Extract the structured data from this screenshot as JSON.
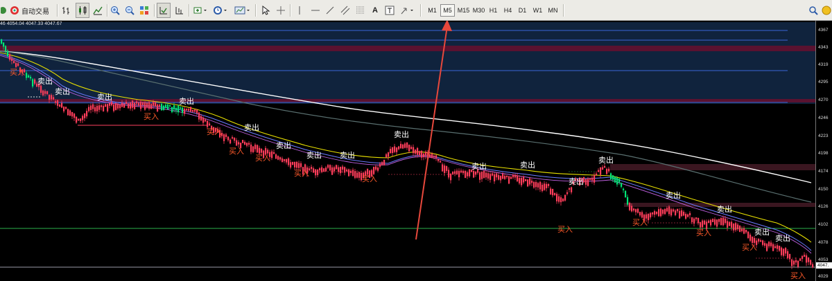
{
  "toolbar": {
    "autotrade_label": "自动交易",
    "text_tool_label": "A",
    "timeframes": [
      "M1",
      "M5",
      "M15",
      "M30",
      "H1",
      "H4",
      "D1",
      "W1",
      "MN"
    ],
    "active_timeframe": "M5"
  },
  "ohlc_text": "46 4054.04 4047.33 4047.67",
  "price_axis": {
    "labels": [
      "4367",
      "4343",
      "4319",
      "4295",
      "4270",
      "4246",
      "4223",
      "4198",
      "4174",
      "4150",
      "4126",
      "4102",
      "4078",
      "4053",
      "4029"
    ],
    "current_price": "4047."
  },
  "signals": {
    "sell_label": "卖出",
    "buy_label": "买入"
  },
  "colors": {
    "background": "#000000",
    "bull_candle": "#00e676",
    "bear_candle": "#ff3d5a",
    "ma_white": "#ffffff",
    "ma_grey": "#5a7070",
    "ma_yellow": "#e8e000",
    "ma_blue": "#4a6cff",
    "sell_text": "#ffffff",
    "buy_text": "#ff5a2a",
    "arrow": "#e8483c",
    "support_line": "#2bb24c"
  }
}
